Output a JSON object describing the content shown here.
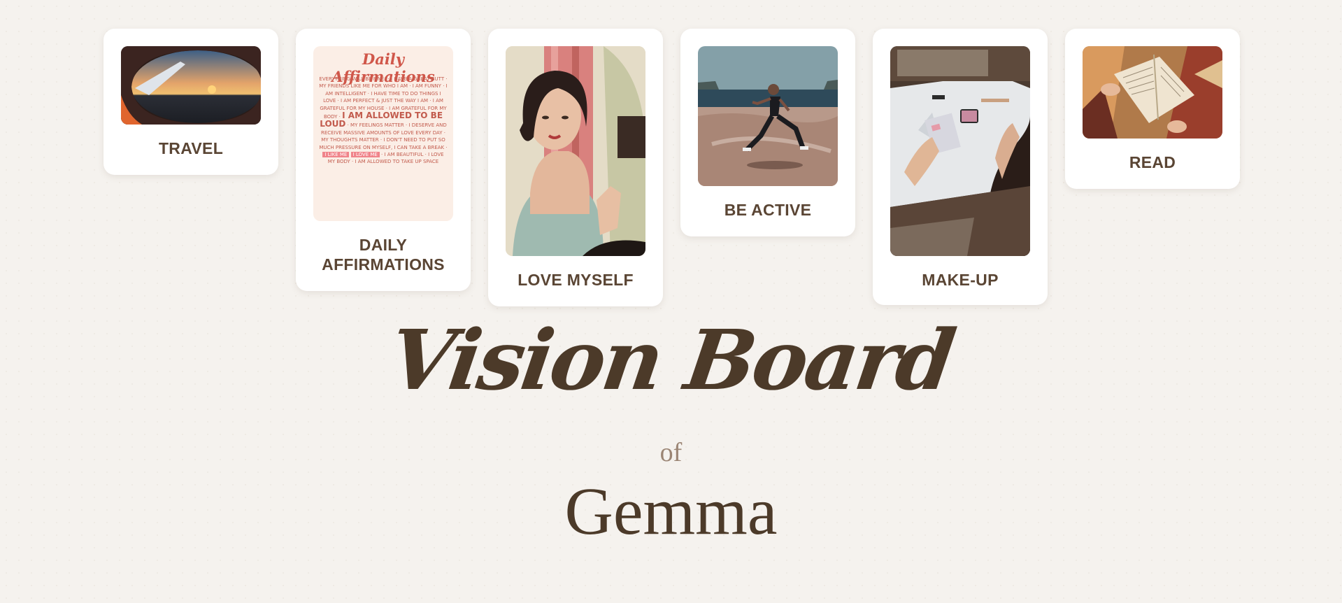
{
  "cards": [
    {
      "label": "TRAVEL",
      "image": "airplane-window-sunset-photo"
    },
    {
      "label": "DAILY AFFIRMATIONS",
      "image": "daily-affirmations-poster",
      "poster": {
        "heading": "Daily Affirmations",
        "lines": [
          "Everything will be fine!",
          "I have a great butt",
          "MY FRIENDS LIKE ME FOR WHO I AM",
          "I am funny",
          "I am intelligent",
          "I HAVE TIME TO DO THINGS I LOVE",
          "I am perfect & just the way I am",
          "I AM GRATEFUL FOR MY HOUSE",
          "I am grateful for my body",
          "I AM ALLOWED TO BE LOUD",
          "My feelings matter",
          "I DESERVE AND RECEIVE MASSIVE AMOUNTS OF LOVE EVERY DAY",
          "My thoughts matter",
          "I DON'T NEED TO PUT SO MUCH PRESSURE ON MYSELF, I CAN TAKE A BREAK",
          "I LIKE ME",
          "I LOVE ME",
          "I AM BEAUTIFUL",
          "I LOVE MY BODY",
          "I AM ALLOWED TO TAKE UP space"
        ]
      }
    },
    {
      "label": "LOVE MYSELF",
      "image": "woman-at-mirror-photo"
    },
    {
      "label": "BE ACTIVE",
      "image": "woman-running-coast-photo"
    },
    {
      "label": "MAKE-UP",
      "image": "makeup-vanity-photo"
    },
    {
      "label": "READ",
      "image": "open-book-photo"
    }
  ],
  "heading": {
    "title": "Vision Board",
    "of": "of",
    "name": "Gemma"
  },
  "colors": {
    "background": "#f5f2ee",
    "card": "#ffffff",
    "text_brown": "#5a4534",
    "title_brown": "#4c3a29",
    "muted": "#9b8574"
  }
}
